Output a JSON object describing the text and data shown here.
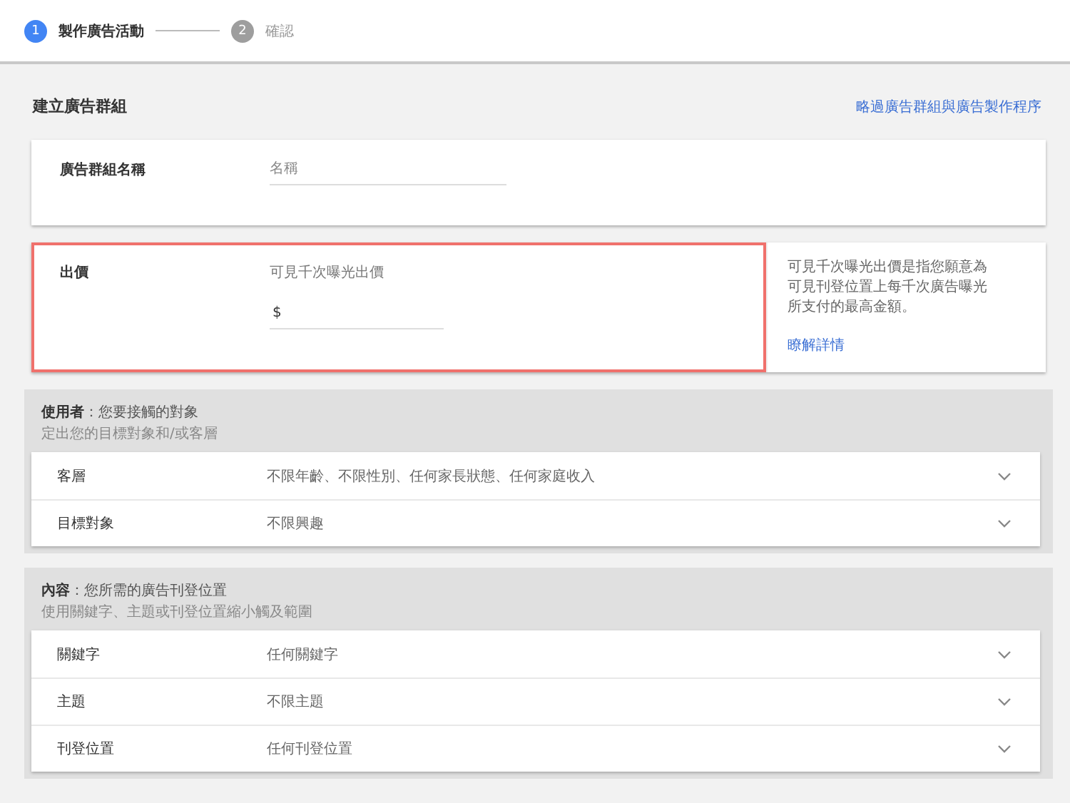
{
  "steps": [
    {
      "number": "1",
      "label": "製作廣告活動",
      "selected": true
    },
    {
      "number": "2",
      "label": "確認",
      "selected": false
    }
  ],
  "page": {
    "title": "建立廣告群組",
    "skip_link": "略過廣告群組與廣告製作程序"
  },
  "name_card": {
    "label": "廣告群組名稱",
    "placeholder": "名稱"
  },
  "bid_card": {
    "label": "出價",
    "field_label": "可見千次曝光出價",
    "prefix": "$",
    "highlighted": true
  },
  "help_card": {
    "text": "可見千次曝光出價是指您願意為可見刊登位置上每千次廣告曝光所支付的最高金額。",
    "link": "瞭解詳情"
  },
  "sections": [
    {
      "title": "**使用者**：您要接觸的對象",
      "subtitle": "定出您的目標對象和/或客層",
      "rows": [
        {
          "label": "客層",
          "value": "不限年齡、不限性別、任何家長狀態、任何家庭收入",
          "expanded": false
        },
        {
          "label": "目標對象",
          "value": "不限興趣",
          "expanded": false
        }
      ]
    },
    {
      "title": "**內容**：您所需的廣告刊登位置",
      "subtitle": "使用關鍵字、主題或刊登位置縮小觸及範圍",
      "rows": [
        {
          "label": "關鍵字",
          "value": "任何關鍵字",
          "expanded": false
        },
        {
          "label": "主題",
          "value": "不限主題",
          "expanded": false
        },
        {
          "label": "刊登位置",
          "value": "任何刊登位置",
          "expanded": false
        }
      ]
    }
  ]
}
